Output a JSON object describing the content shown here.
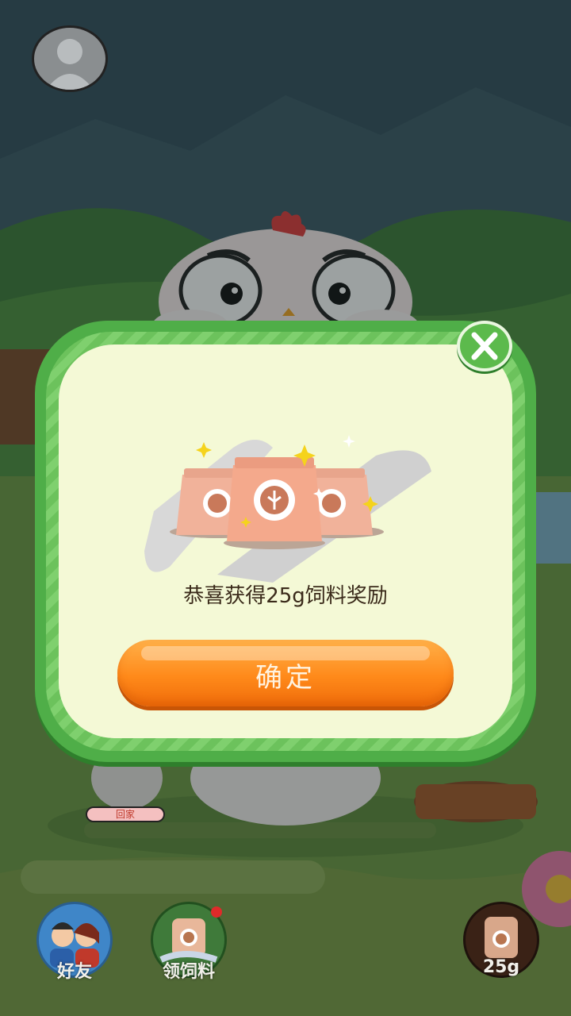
{
  "dialog": {
    "message": "恭喜获得25g饲料奖励",
    "confirm_label": "确定"
  },
  "hud": {
    "nest_tag": "回家",
    "feed_amount": "25g"
  },
  "bottom_nav": {
    "friends_label": "好友",
    "claim_feed_label": "领饲料"
  },
  "colors": {
    "frame_green": "#4fae48",
    "panel_bg": "#f4f9d6",
    "button_orange": "#ff8a1a",
    "text_dark": "#3a2a1a"
  },
  "icons": [
    "avatar-placeholder-icon",
    "close-icon",
    "feed-bag-icon",
    "sparkle-icon",
    "friends-icon",
    "claim-feed-icon",
    "feed-bag-icon"
  ]
}
